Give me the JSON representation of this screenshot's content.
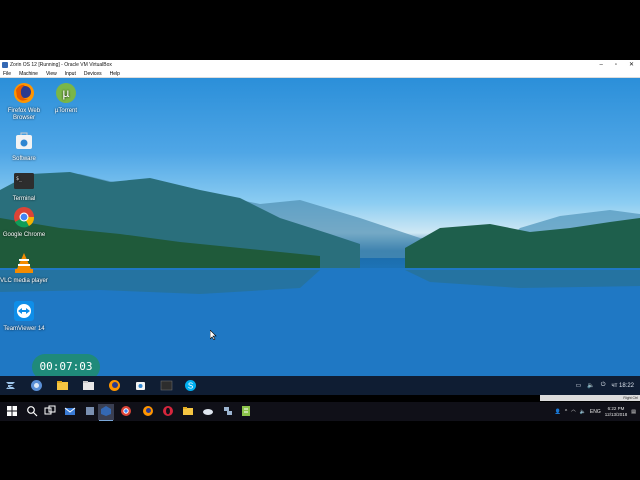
{
  "window": {
    "title": "Zorin OS 12 [Running] - Oracle VM VirtualBox",
    "menu": [
      "File",
      "Machine",
      "View",
      "Input",
      "Devices",
      "Help"
    ],
    "controls": [
      "–",
      "▫",
      "✕"
    ]
  },
  "desktop": {
    "icons": [
      {
        "name": "firefox",
        "label": "Firefox Web Browser",
        "icon": "firefox-icon"
      },
      {
        "name": "utorrent",
        "label": "µTorrent",
        "icon": "utorrent-icon"
      },
      {
        "name": "software",
        "label": "Software",
        "icon": "software-store-icon"
      },
      {
        "name": "terminal",
        "label": "Terminal",
        "icon": "terminal-icon"
      },
      {
        "name": "chrome",
        "label": "Google Chrome",
        "icon": "chrome-icon"
      },
      {
        "name": "vlc",
        "label": "VLC media player",
        "icon": "vlc-icon"
      },
      {
        "name": "teamviewer",
        "label": "TeamViewer 14",
        "icon": "teamviewer-icon"
      }
    ]
  },
  "timer": "00:07:03",
  "zorin_panel": {
    "apps": [
      "zorin-menu-icon",
      "web-icon",
      "files-folder-icon",
      "file-manager-icon",
      "firefox-icon",
      "software-store-icon",
      "terminal-icon",
      "skype-icon"
    ],
    "clock": "чт 18:22"
  },
  "vbox_status": "Right Ctrl",
  "win_taskbar": {
    "apps": [
      "windows-start-icon",
      "search-icon",
      "task-view-icon",
      "mail-icon",
      "virtualbox-icon",
      "virtualbox-active-icon",
      "chrome-icon",
      "firefox-icon",
      "opera-icon",
      "file-explorer-icon",
      "cloud-icon",
      "network-icon",
      "notepad-icon"
    ],
    "lang": "ENG",
    "time": "6:22 PM",
    "date": "12/13/2018"
  },
  "colors": {
    "zorin_panel": "#0f1d33",
    "timer": "#1f8a7a",
    "win_taskbar": "#101018"
  }
}
